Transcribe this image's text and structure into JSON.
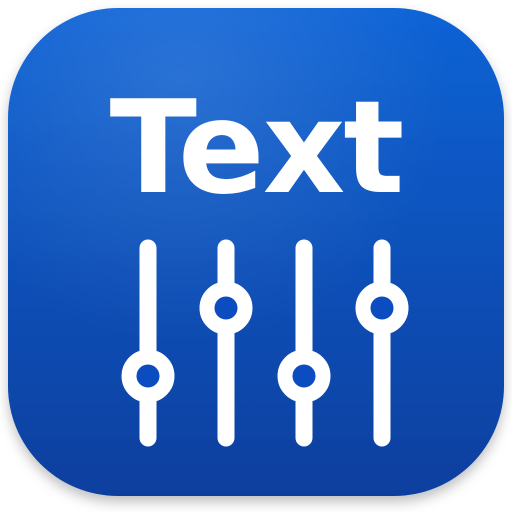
{
  "app_icon": {
    "label": "Text",
    "icon": "sliders-icon",
    "colors": {
      "background_top": "#0a63d6",
      "background_bottom": "#0a3f9e",
      "background_edge": "#0b4cc0",
      "foreground": "#ffffff"
    },
    "sliders": [
      {
        "name": "slider-1",
        "level": 0.18
      },
      {
        "name": "slider-2",
        "level": 0.72
      },
      {
        "name": "slider-3",
        "level": 0.18
      },
      {
        "name": "slider-4",
        "level": 0.72
      }
    ]
  }
}
